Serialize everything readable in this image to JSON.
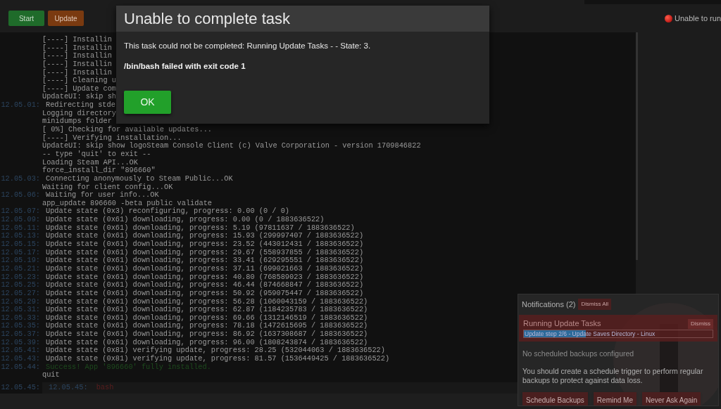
{
  "toolbar": {
    "buttons": [
      {
        "label": "Start",
        "kind": "start"
      },
      {
        "label": "Update",
        "kind": "update"
      }
    ]
  },
  "status": {
    "text": "Unable to run"
  },
  "console": {
    "lines": [
      {
        "text": "[----] Installin"
      },
      {
        "text": "[----] Installin"
      },
      {
        "text": "[----] Installin"
      },
      {
        "text": "[----] Installin"
      },
      {
        "text": "[----] Installin"
      },
      {
        "text": "[----] Cleaning u"
      },
      {
        "text": "[----] Update com"
      },
      {
        "text": "UpdateUI: skip sh"
      },
      {
        "time": "12.05.01:",
        "text": "Redirecting stde"
      },
      {
        "text": "Logging directory"
      },
      {
        "text": "minidumps folder"
      },
      {
        "text": "[ 0%] Checking for available updates..."
      },
      {
        "text": "[----] Verifying installation..."
      },
      {
        "text": "UpdateUI: skip show logoSteam Console Client (c) Valve Corporation - version 1709846822"
      },
      {
        "text": "-- type 'quit' to exit --"
      },
      {
        "text": "Loading Steam API...OK"
      },
      {
        "text": "force_install_dir \"896660\""
      },
      {
        "time": "12.05.03:",
        "text": "Connecting anonymously to Steam Public...OK"
      },
      {
        "text": "Waiting for client config...OK"
      },
      {
        "time": "12.05.06:",
        "text": "Waiting for user info...OK"
      },
      {
        "text": "app_update 896660 -beta public validate"
      },
      {
        "time": "12.05.07:",
        "text": "Update state (0x3) reconfiguring, progress: 0.00 (0 / 0)"
      },
      {
        "time": "12.05.09:",
        "text": "Update state (0x61) downloading, progress: 0.00 (0 / 1883636522)"
      },
      {
        "time": "12.05.11:",
        "text": "Update state (0x61) downloading, progress: 5.19 (97811637 / 1883636522)"
      },
      {
        "time": "12.05.13:",
        "text": "Update state (0x61) downloading, progress: 15.93 (299997407 / 1883636522)"
      },
      {
        "time": "12.05.15:",
        "text": "Update state (0x61) downloading, progress: 23.52 (443012431 / 1883636522)"
      },
      {
        "time": "12.05.17:",
        "text": "Update state (0x61) downloading, progress: 29.67 (558937855 / 1883636522)"
      },
      {
        "time": "12.05.19:",
        "text": "Update state (0x61) downloading, progress: 33.41 (629295551 / 1883636522)"
      },
      {
        "time": "12.05.21:",
        "text": "Update state (0x61) downloading, progress: 37.11 (699021663 / 1883636522)"
      },
      {
        "time": "12.05.23:",
        "text": "Update state (0x61) downloading, progress: 40.80 (768589023 / 1883636522)"
      },
      {
        "time": "12.05.25:",
        "text": "Update state (0x61) downloading, progress: 46.44 (874668847 / 1883636522)"
      },
      {
        "time": "12.05.27:",
        "text": "Update state (0x61) downloading, progress: 50.92 (959075447 / 1883636522)"
      },
      {
        "time": "12.05.29:",
        "text": "Update state (0x61) downloading, progress: 56.28 (1060043159 / 1883636522)"
      },
      {
        "time": "12.05.31:",
        "text": "Update state (0x61) downloading, progress: 62.87 (1184235783 / 1883636522)"
      },
      {
        "time": "12.05.33:",
        "text": "Update state (0x61) downloading, progress: 69.66 (1312146519 / 1883636522)"
      },
      {
        "time": "12.05.35:",
        "text": "Update state (0x61) downloading, progress: 78.18 (1472615695 / 1883636522)"
      },
      {
        "time": "12.05.37:",
        "text": "Update state (0x61) downloading, progress: 86.92 (1637308687 / 1883636522)"
      },
      {
        "time": "12.05.39:",
        "text": "Update state (0x61) downloading, progress: 96.00 (1808243874 / 1883636522)"
      },
      {
        "time": "12.05.41:",
        "text": "Update state (0x81) verifying update, progress: 28.25 (532044063 / 1883636522)"
      },
      {
        "time": "12.05.43:",
        "text": "Update state (0x81) verifying update, progress: 81.57 (1536449425 / 1883636522)"
      },
      {
        "time": "12.05.44:",
        "text": "Success! App '896660' fully installed.",
        "kind": "success"
      },
      {
        "text": "quit"
      }
    ],
    "input": {
      "time": "12.05.45:",
      "prompt_time": "12.05.45:",
      "value": "bash"
    }
  },
  "dialog": {
    "title": "Unable to complete task",
    "message": "This task could not be completed: Running Update Tasks - - State: 3.",
    "detail": "/bin/bash failed with exit code 1",
    "button": "OK"
  },
  "notifications": {
    "title": "Notifications (2)",
    "dismiss_all": "Dismiss All",
    "items": [
      {
        "kind": "task",
        "title": "Running Update Tasks",
        "dismiss": "Dismiss",
        "progress": {
          "level": 0.33,
          "label": "Update step 2/6 - Update Saves Directory - Linux"
        }
      },
      {
        "kind": "prompt",
        "title": "No scheduled backups configured",
        "text": "You should create a schedule trigger to perform regular backups to protect against data loss.",
        "buttons": [
          "Schedule Backups",
          "Remind Me",
          "Never Ask Again"
        ]
      }
    ]
  }
}
